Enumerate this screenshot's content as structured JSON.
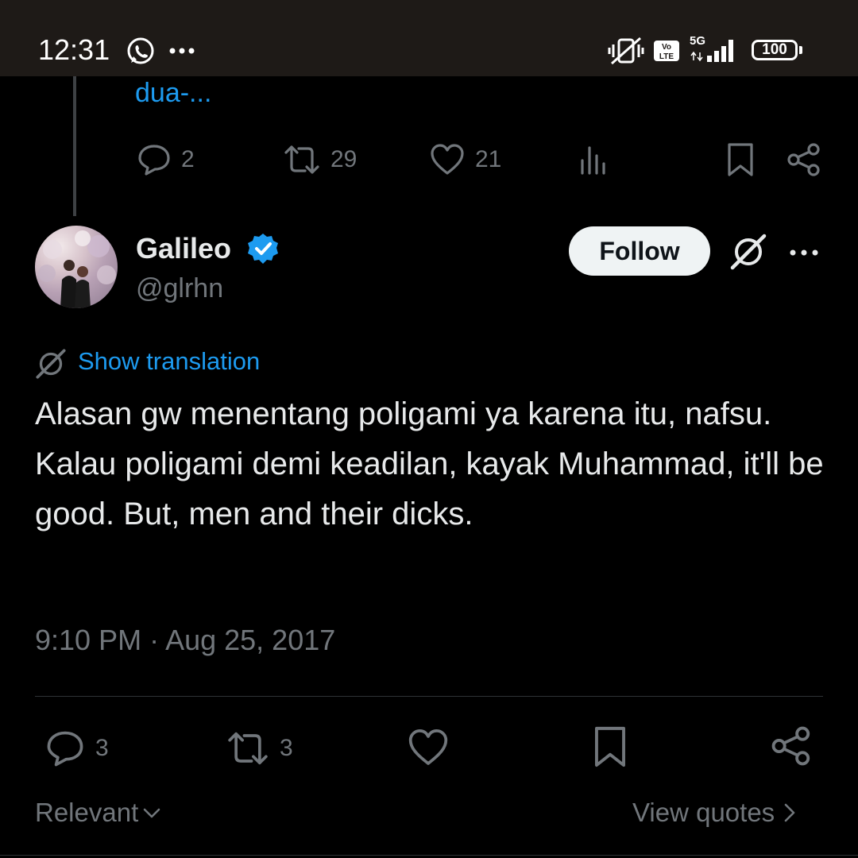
{
  "status_bar": {
    "time": "12:31",
    "battery": "100",
    "network": "5G",
    "volte": "Vo LTE"
  },
  "previous_tweet": {
    "truncated_text": "dua-...",
    "replies": "2",
    "retweets": "29",
    "likes": "21"
  },
  "tweet": {
    "author_name": "Galileo",
    "handle": "@glrhn",
    "follow_label": "Follow",
    "translate_label": "Show translation",
    "text": "Alasan gw menentang poligami ya karena itu, nafsu. Kalau poligami demi keadilan, kayak Muhammad, it'll be good. But, men and their dicks.",
    "timestamp": "9:10 PM · Aug 25, 2017",
    "replies": "3",
    "retweets": "3"
  },
  "footer": {
    "sort_label": "Relevant",
    "quotes_label": "View quotes"
  },
  "colors": {
    "background": "#000000",
    "text": "#e7e9ea",
    "muted": "#71767b",
    "link": "#1d9bf0",
    "verified": "#1d9bf0",
    "status_bar": "#1e1a17"
  },
  "icons": [
    "whatsapp-icon",
    "more-dots-icon",
    "vibrate-off-icon",
    "volte-icon",
    "signal-icon",
    "battery-icon",
    "reply-icon",
    "retweet-icon",
    "like-icon",
    "views-icon",
    "bookmark-icon",
    "share-icon",
    "verified-badge-icon",
    "grok-icon",
    "translate-icon",
    "chevron-down-icon",
    "chevron-right-icon"
  ]
}
